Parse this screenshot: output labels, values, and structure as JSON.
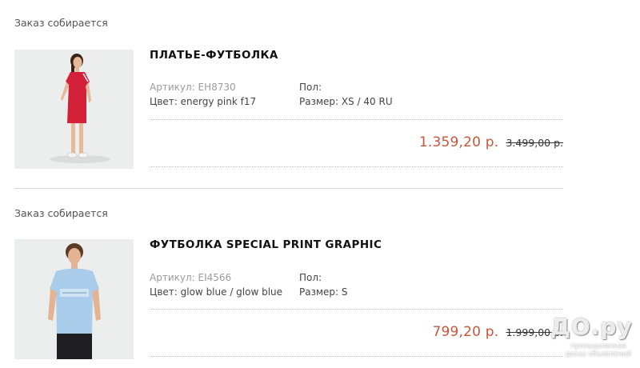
{
  "orders": [
    {
      "status": "Заказ собирается",
      "title": "ПЛАТЬЕ-ФУТБОЛКА",
      "article_label": "Артикул: EH8730",
      "color_label": "Цвет:",
      "color_value": "energy pink f17",
      "gender_label": "Пол:",
      "size_label": "Размер:",
      "size_value": "XS / 40 RU",
      "price": "1.359,20 р.",
      "old_price": "3.499,00 р.",
      "image_icon": "pink-dress-product-photo"
    },
    {
      "status": "Заказ собирается",
      "title": "ФУТБОЛКА SPECIAL PRINT GRAPHIC",
      "article_label": "Артикул: EI4566",
      "color_label": "Цвет:",
      "color_value": "glow blue / glow blue",
      "gender_label": "Пол:",
      "size_label": "Размер:",
      "size_value": "S",
      "price": "799,20 р.",
      "old_price": "1.999,00 р.",
      "image_icon": "blue-tshirt-product-photo"
    }
  ],
  "watermark": {
    "main": "ДО.ру",
    "sub": "промышленная доска объявлений"
  },
  "colors": {
    "price": "#c8563b",
    "dress": "#d3213a",
    "tshirt": "#a9cdea"
  }
}
